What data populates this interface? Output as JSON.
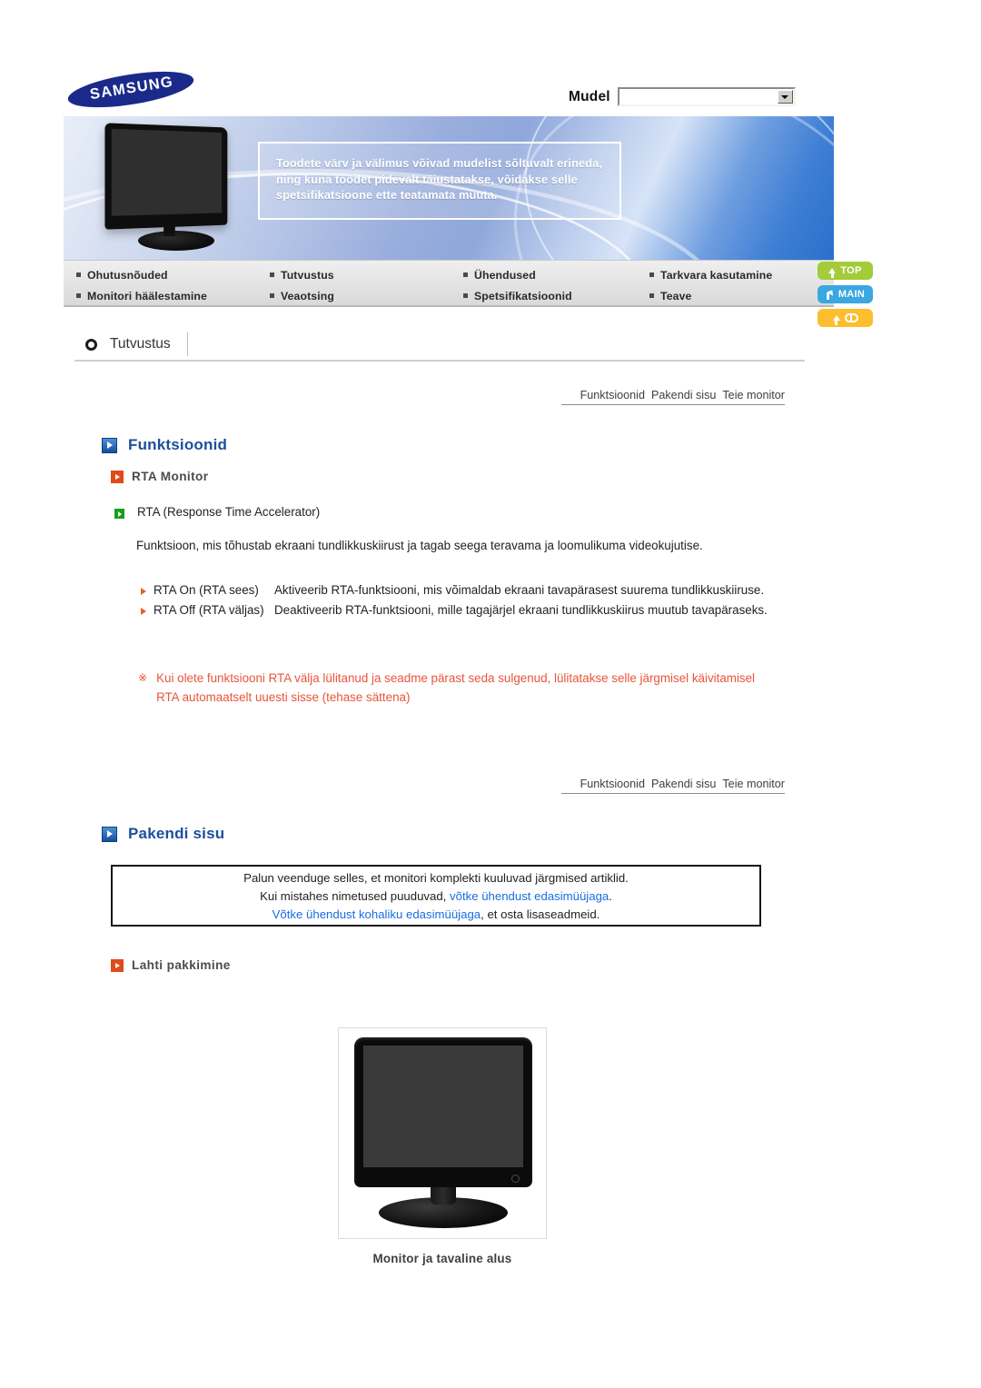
{
  "header": {
    "logo_text": "SAMSUNG",
    "model_label": "Mudel",
    "model_value": "",
    "model_placeholder": ""
  },
  "banner": {
    "notice": "Toodete värv ja välimus võivad mudelist sõltuvalt erineda, ning kuna toodet pidevalt täiustatakse, võidakse selle spetsifikatsioone ette teatamata muuta."
  },
  "navbar": {
    "items": [
      {
        "label": "Ohutusnõuded"
      },
      {
        "label": "Tutvustus"
      },
      {
        "label": "Ühendused"
      },
      {
        "label": "Tarkvara kasutamine"
      },
      {
        "label": "Monitori häälestamine"
      },
      {
        "label": "Veaotsing"
      },
      {
        "label": "Spetsifikatsioonid"
      },
      {
        "label": "Teave"
      }
    ]
  },
  "side_buttons": [
    {
      "label": "TOP",
      "color": "#a4cb39",
      "icon": "arrow-up-icon"
    },
    {
      "label": "MAIN",
      "color": "#3aa7e0",
      "icon": "arrow-bent-icon"
    },
    {
      "label": "",
      "color": "#fcbe2c",
      "icon": "arrow-up-book-icon"
    }
  ],
  "section": {
    "tab_label": "Tutvustus"
  },
  "subnav": {
    "items": [
      {
        "label": "Funktsioonid"
      },
      {
        "label": "Pakendi sisu"
      },
      {
        "label": "Teie monitor"
      }
    ]
  },
  "funktsioonid": {
    "heading": "Funktsioonid",
    "sub_heading": "RTA Monitor",
    "rta_title": "RTA (Response Time Accelerator)",
    "rta_description": "Funktsioon, mis tõhustab ekraani tundlikkuskiirust ja tagab seega teravama ja loomulikuma videokujutise.",
    "rows": [
      {
        "term": "RTA On (RTA sees)",
        "definition": "Aktiveerib RTA-funktsiooni, mis võimaldab ekraani tavapärasest suurema tundlikkuskiiruse."
      },
      {
        "term": "RTA Off (RTA väljas)",
        "definition": "Deaktiveerib RTA-funktsiooni, mille tagajärjel ekraani tundlikkuskiirus muutub tavapäraseks."
      }
    ],
    "note_mark": "※",
    "note": "Kui olete funktsiooni RTA välja lülitanud ja seadme pärast seda sulgenud, lülitatakse selle järgmisel käivitamisel RTA automaatselt uuesti sisse (tehase sättena)",
    "note_color": "#e8553a"
  },
  "pakendi_sisu": {
    "heading": "Pakendi sisu",
    "box_line1": "Palun veenduge selles, et monitori komplekti kuuluvad järgmised artiklid.",
    "box_line2_prefix": "Kui mistahes nimetused puuduvad, ",
    "box_line2_link": "võtke ühendust edasimüüjaga",
    "box_line2_suffix": ".",
    "box_line3_link": "Võtke ühendust kohaliku edasimüüjaga",
    "box_line3_suffix": ", et osta lisaseadmeid.",
    "link_color": "#1a6ee0",
    "sub_heading": "Lahti pakkimine",
    "figure_caption": "Monitor ja tavaline alus"
  }
}
